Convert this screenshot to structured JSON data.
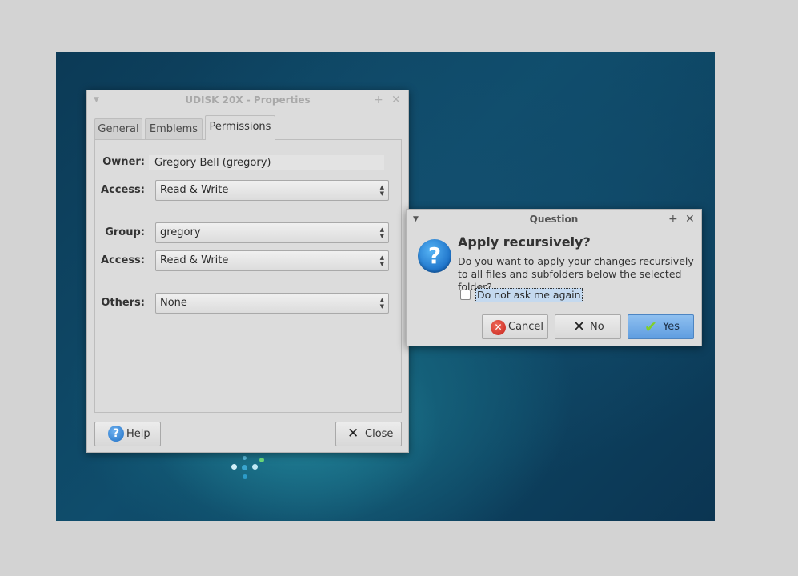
{
  "properties_window": {
    "title": "UDISK 20X - Properties",
    "tabs": [
      {
        "label": "General",
        "active": false
      },
      {
        "label": "Emblems",
        "active": false
      },
      {
        "label": "Permissions",
        "active": true
      }
    ],
    "owner": {
      "label": "Owner:",
      "value": "Gregory Bell (gregory)"
    },
    "owner_access": {
      "label": "Access:",
      "value": "Read & Write"
    },
    "group": {
      "label": "Group:",
      "value": "gregory"
    },
    "group_access": {
      "label": "Access:",
      "value": "Read & Write"
    },
    "others": {
      "label": "Others:",
      "value": "None"
    },
    "help_button": "Help",
    "close_button": "Close"
  },
  "question_dialog": {
    "title": "Question",
    "heading": "Apply recursively?",
    "message": "Do you want to apply your changes recursively to all files and subfolders below the selected folder?",
    "checkbox_label": "Do not ask me again",
    "checkbox_checked": false,
    "cancel_button": "Cancel",
    "no_button": "No",
    "yes_button": "Yes"
  },
  "icons": {
    "titlebar_menu": "chevron-down-icon",
    "titlebar_pin": "pin-icon",
    "titlebar_close": "close-icon",
    "question": "question-icon",
    "help": "help-icon",
    "close": "close-x-icon",
    "cancel": "cancel-icon",
    "no": "no-x-icon",
    "yes": "checkmark-icon",
    "busy": "spinner-icon"
  },
  "colors": {
    "window_bg": "#dcdcdc",
    "desktop_bg": "#0f4d6c",
    "yes_button": "#5f9de0",
    "selection_highlight": "#c4d9ef"
  }
}
